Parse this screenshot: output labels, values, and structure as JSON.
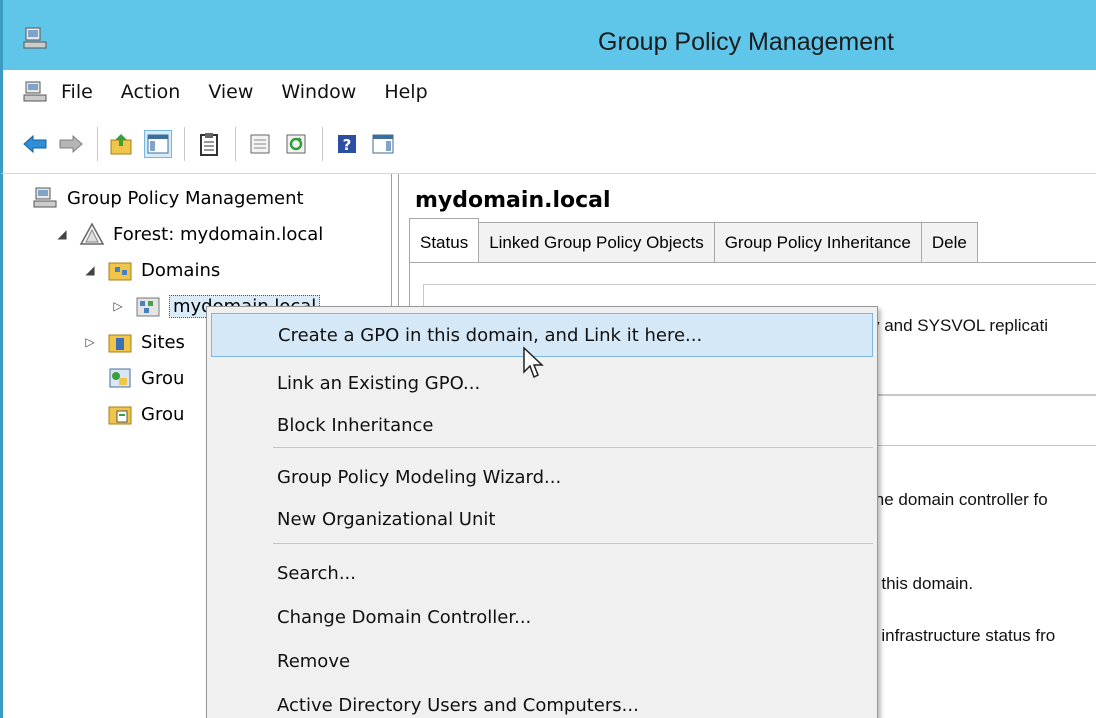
{
  "window": {
    "title": "Group Policy Management"
  },
  "menubar": {
    "items": [
      "File",
      "Action",
      "View",
      "Window",
      "Help"
    ]
  },
  "toolbar": {
    "buttons": [
      "back-arrow-icon",
      "forward-arrow-icon",
      "up-folder-icon",
      "show-hide-tree-icon",
      "clipboard-icon",
      "properties-icon",
      "refresh-icon",
      "help-icon",
      "show-action-pane-icon"
    ]
  },
  "tree": {
    "root": "Group Policy Management",
    "forest": "Forest: mydomain.local",
    "domains": "Domains",
    "domain": "mydomain.local",
    "sites": "Sites",
    "group1": "Grou",
    "group2": "Grou"
  },
  "details": {
    "title": "mydomain.local",
    "tabs": [
      "Status",
      "Linked Group Policy Objects",
      "Group Policy Inheritance",
      "Dele"
    ],
    "lines": [
      "y and SYSVOL replicati",
      "ine domain controller fo",
      "r this domain.",
      "r infrastructure status fro"
    ]
  },
  "context_menu": {
    "items": [
      "Create a GPO in this domain, and Link it here...",
      "Link an Existing GPO...",
      "Block Inheritance",
      "Group Policy Modeling Wizard...",
      "New Organizational Unit",
      "Search...",
      "Change Domain Controller...",
      "Remove",
      "Active Directory Users and Computers..."
    ]
  },
  "colors": {
    "titlebar": "#5fc6ea",
    "highlight": "#d5e8f7",
    "menu_bg": "#f0f0f0"
  }
}
